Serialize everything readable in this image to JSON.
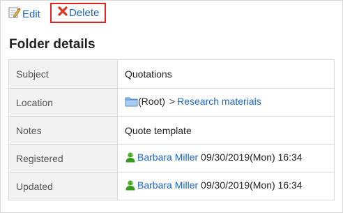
{
  "toolbar": {
    "edit_label": "Edit",
    "delete_label": "Delete",
    "edit_icon": "pencil-edit-icon",
    "delete_icon": "red-x-delete-icon",
    "highlight_color": "#e02424"
  },
  "page": {
    "title": "Folder details"
  },
  "details": {
    "subject_label": "Subject",
    "subject_value": "Quotations",
    "location_label": "Location",
    "location_root": "(Root)",
    "location_separator": ">",
    "location_folder": "Research materials",
    "notes_label": "Notes",
    "notes_value": "Quote template",
    "registered_label": "Registered",
    "registered_user": "Barbara Miller",
    "registered_time": "09/30/2019(Mon) 16:34",
    "updated_label": "Updated",
    "updated_user": "Barbara Miller",
    "updated_time": "09/30/2019(Mon) 16:34"
  },
  "colors": {
    "link": "#1d64c2",
    "label_bg": "#f2f2f2",
    "border": "#d8d8d8",
    "user_icon": "#3a9a1e",
    "folder_icon": "#6fa8dc"
  }
}
